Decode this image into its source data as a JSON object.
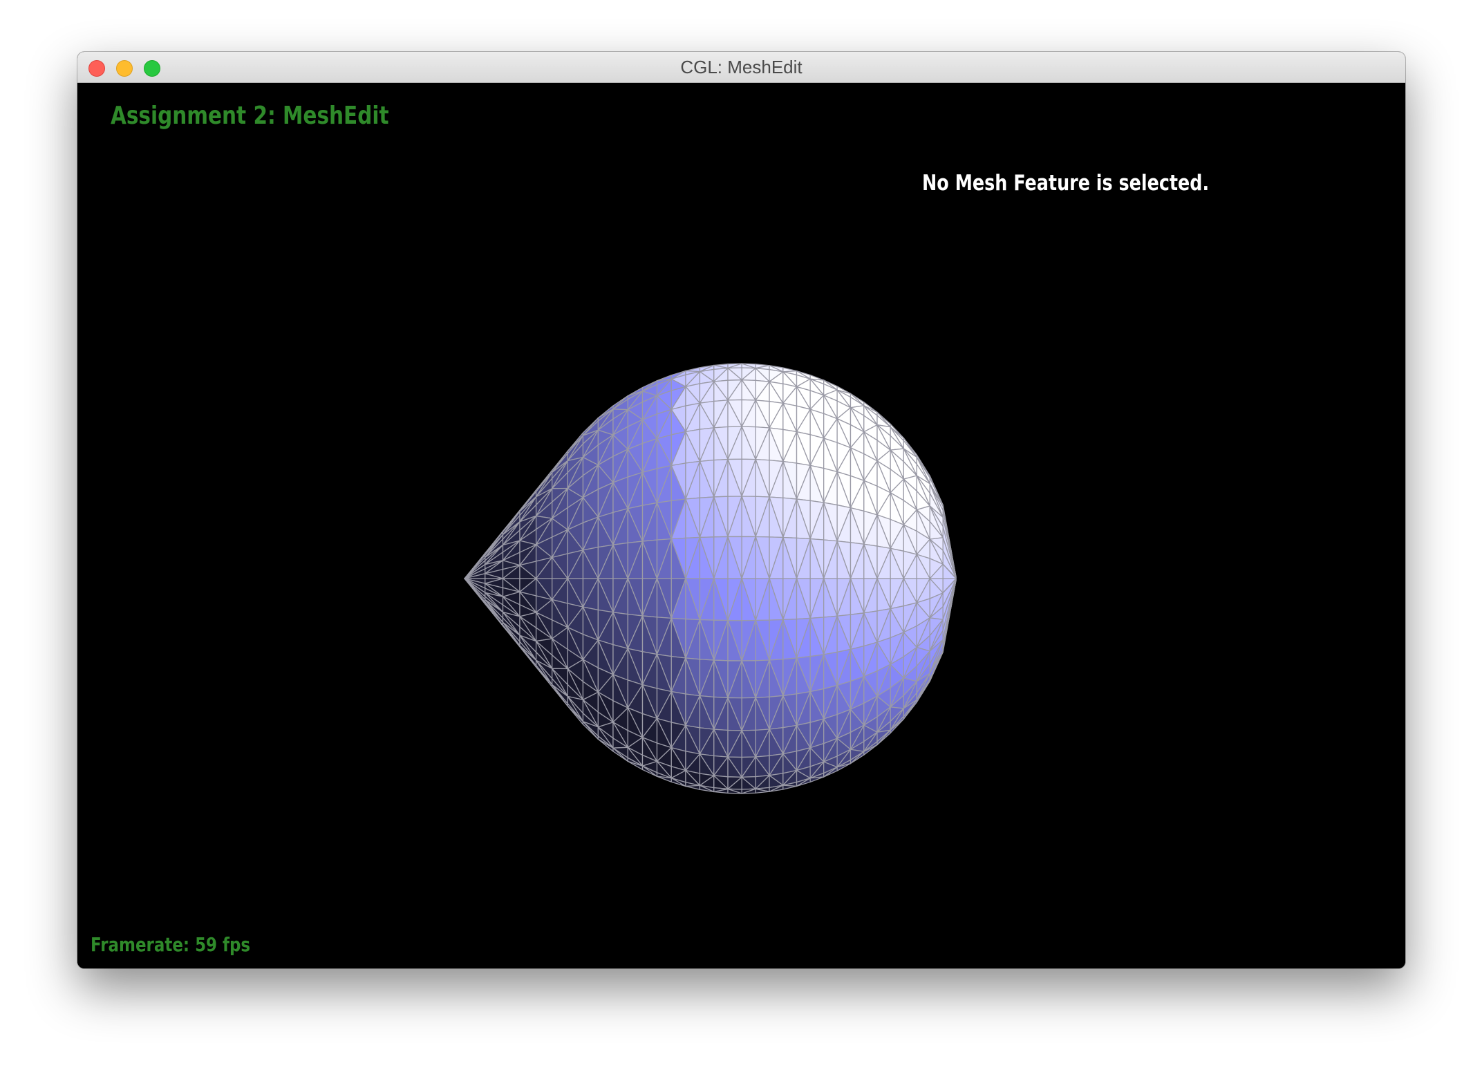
{
  "window": {
    "title": "CGL: MeshEdit"
  },
  "viewport": {
    "app_title": "Assignment 2: MeshEdit",
    "selection_status": "No Mesh Feature is selected.",
    "framerate": "Framerate: 59 fps"
  },
  "mesh": {
    "shape": "teardrop",
    "base_color": "#8a8cff",
    "edge_color": "#9a9aa6",
    "background": "#000000"
  },
  "colors": {
    "label_green": "#2f8a2a",
    "status_white": "#ffffff"
  }
}
